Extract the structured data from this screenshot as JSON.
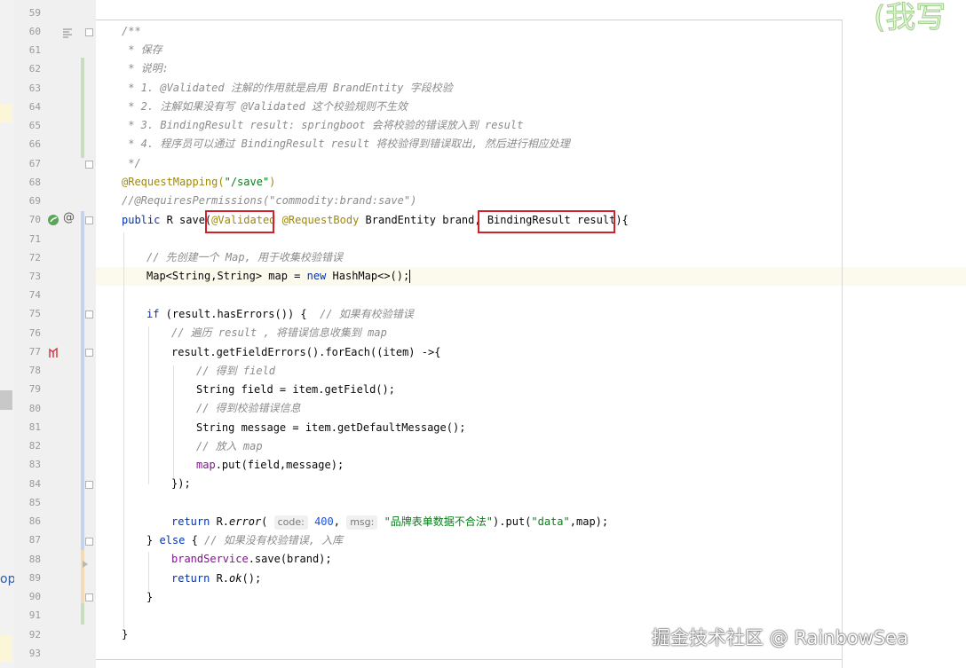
{
  "editor": {
    "line_numbers": [
      "59",
      "60",
      "61",
      "62",
      "63",
      "64",
      "65",
      "66",
      "67",
      "68",
      "69",
      "70",
      "71",
      "72",
      "73",
      "74",
      "75",
      "76",
      "77",
      "78",
      "79",
      "80",
      "81",
      "82",
      "83",
      "84",
      "85",
      "86",
      "87",
      "88",
      "89",
      "90",
      "91",
      "92",
      "93"
    ],
    "javadoc_open": "/**",
    "javadoc_save": " * 保存",
    "javadoc_note": " * 说明:",
    "javadoc_1": " * 1. @Validated 注解的作用就是启用 BrandEntity 字段校验",
    "javadoc_2": " * 2. 注解如果没有写 @Validated 这个校验规则不生效",
    "javadoc_3": " * 3. BindingResult result: springboot 会将校验的错误放入到 result",
    "javadoc_4": " * 4. 程序员可以通过 BindingResult result 将校验得到错误取出, 然后进行相应处理",
    "javadoc_close": " */",
    "ann_request_mapping": "@RequestMapping(",
    "save_path": "\"/save\"",
    "close_paren": ")",
    "commented_permissions": "//@RequiresPermissions(\"commodity:brand:save\")",
    "kw_public": "public",
    "method_sig_mid": " R save(",
    "ann_validated": "@Validated",
    "ann_request_body": " @RequestBody",
    "param_brand": " BrandEntity brand, ",
    "param_binding": "BindingResult result",
    "method_open": "){",
    "comment_create_map": "// 先创建一个 Map, 用于收集校验错误",
    "map_decl_a": "Map<String,String> map = ",
    "kw_new": "new",
    "map_decl_b": " HashMap<>();",
    "kw_if": "if",
    "if_cond": " (result.hasErrors()) {  ",
    "comment_if": "// 如果有校验错误",
    "comment_iterate": "// 遍历 result , 将错误信息收集到 map",
    "foreach_line": "result.getFieldErrors().forEach((item) ->{",
    "comment_get_field": "// 得到 field",
    "field_line": "String field = item.getField();",
    "comment_get_msg": "// 得到校验错误信息",
    "message_line": "String message = item.getDefaultMessage();",
    "comment_put": "// 放入 map",
    "put_prefix": "map",
    "put_line": ".put(field,message);",
    "lambda_close": "});",
    "kw_return": "return",
    "r_prefix": " R.",
    "error_method": "error",
    "open_paren": "( ",
    "hint_code": "code:",
    "code_value": " 400",
    "comma_space": ", ",
    "hint_msg": "msg:",
    "error_msg": " \"品牌表单数据不合法\"",
    "put_data_a": ").put(",
    "data_key": "\"data\"",
    "put_data_b": ",map);",
    "else_open": "} ",
    "kw_else": "else",
    "else_brace": " { ",
    "comment_else": "// 如果没有校验错误, 入库",
    "brand_service": "brandService",
    "save_call": ".save(brand);",
    "ok_method": "ok",
    "ok_tail": "();",
    "close_brace": "}",
    "left_partial_text": "op"
  },
  "overlay": {
    "watermark": "掘金技术社区 @ RainbowSea",
    "corner_text": "(我写"
  },
  "colors": {
    "keyword": "#0033b3",
    "annotation": "#9e880d",
    "comment": "#8c8c8c",
    "string": "#067d17",
    "highlight_box": "#d0202a"
  }
}
